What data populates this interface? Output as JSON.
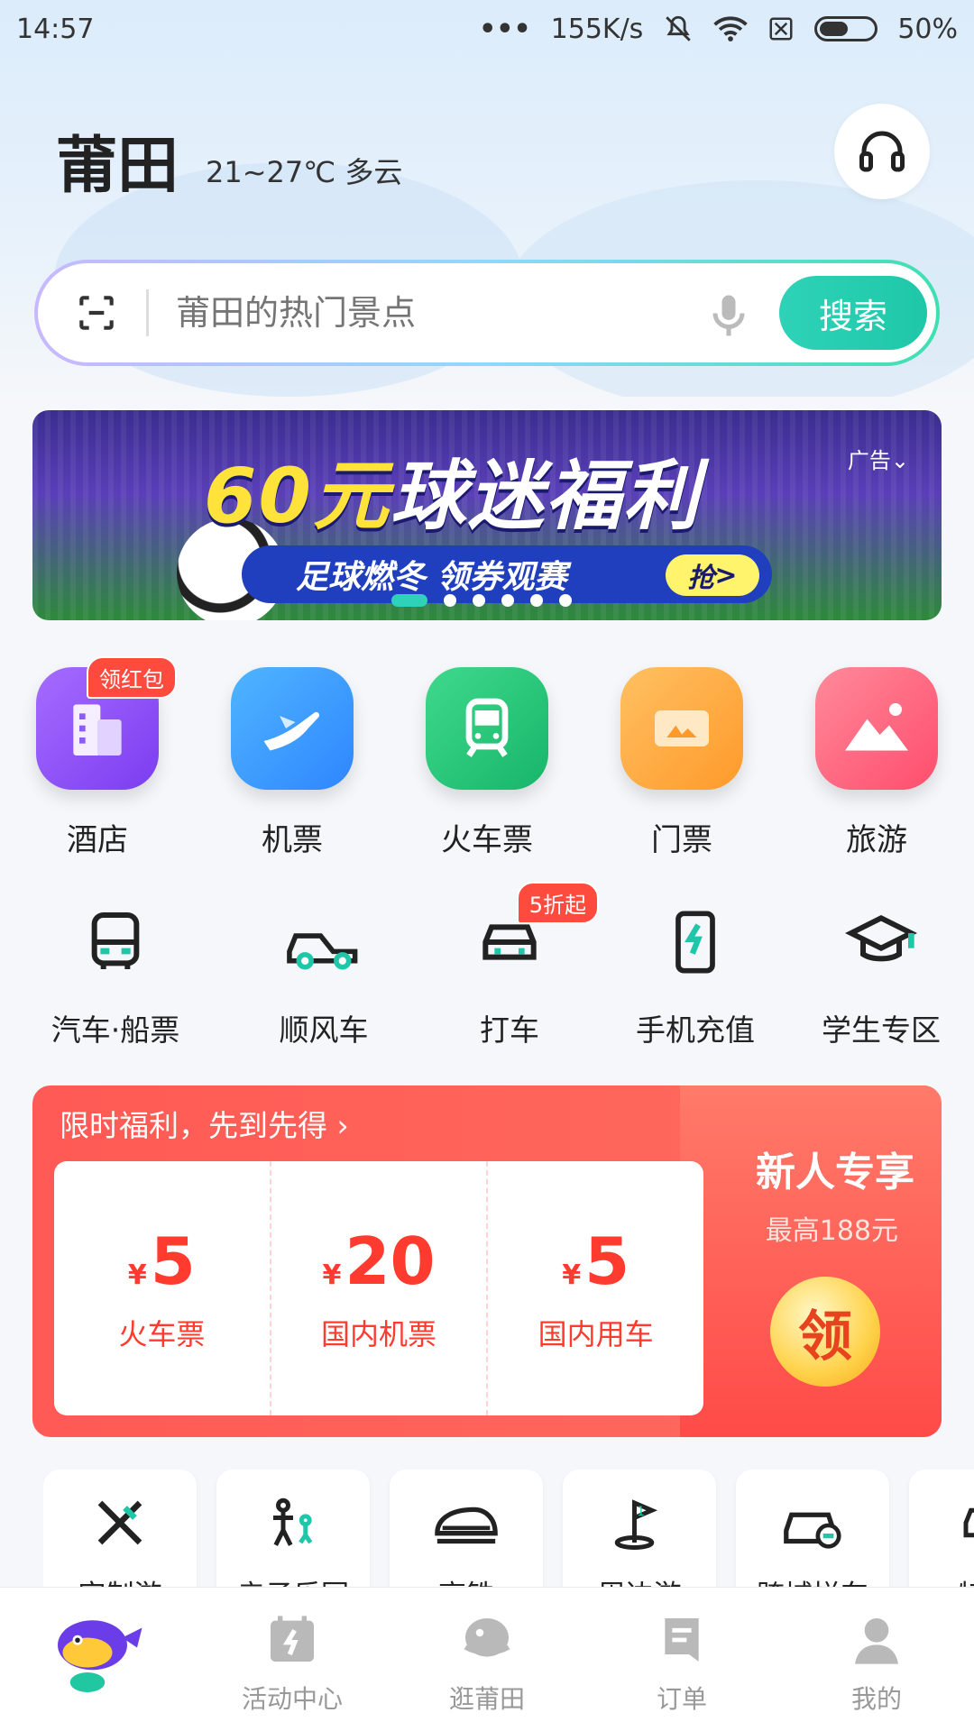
{
  "status_bar": {
    "time": "14:57",
    "speed": "155K/s",
    "battery": "50%"
  },
  "header": {
    "city": "莆田",
    "weather": "21~27℃ 多云"
  },
  "search": {
    "placeholder": "莆田的热门景点",
    "button": "搜索"
  },
  "banner": {
    "title_num": "60元",
    "title_text": "球迷福利",
    "subtitle": "足球燃冬 领券观赛",
    "cta": "抢",
    "ad_label": "广告",
    "page_count": 6,
    "active_page": 1
  },
  "main_grid": [
    {
      "label": "酒店",
      "icon": "hotel-icon",
      "color": "#8b5cf6",
      "badge": "领红包"
    },
    {
      "label": "机票",
      "icon": "plane-icon",
      "color": "#3b9bff",
      "badge": ""
    },
    {
      "label": "火车票",
      "icon": "train-icon",
      "color": "#22c27a",
      "badge": ""
    },
    {
      "label": "门票",
      "icon": "ticket-icon",
      "color": "#ffa23a",
      "badge": ""
    },
    {
      "label": "旅游",
      "icon": "mountain-icon",
      "color": "#ff5f7a",
      "badge": ""
    }
  ],
  "sub_grid": [
    {
      "label": "汽车·船票",
      "icon": "bus-icon",
      "badge": ""
    },
    {
      "label": "顺风车",
      "icon": "carpool-icon",
      "badge": ""
    },
    {
      "label": "打车",
      "icon": "taxi-icon",
      "badge": "5折起"
    },
    {
      "label": "手机充值",
      "icon": "phone-charge-icon",
      "badge": ""
    },
    {
      "label": "学生专区",
      "icon": "graduation-cap-icon",
      "badge": ""
    }
  ],
  "promo": {
    "header": "限时福利，先到先得",
    "tickets": [
      {
        "currency": "¥",
        "amount": "5",
        "name": "火车票"
      },
      {
        "currency": "¥",
        "amount": "20",
        "name": "国内机票"
      },
      {
        "currency": "¥",
        "amount": "5",
        "name": "国内用车"
      }
    ],
    "new_user": "新人专享",
    "max": "最高188元",
    "claim": "领"
  },
  "cards": [
    {
      "label": "定制游",
      "icon": "custom-tour-icon"
    },
    {
      "label": "亲子乐园",
      "icon": "family-park-icon"
    },
    {
      "label": "高铁",
      "icon": "high-speed-rail-icon"
    },
    {
      "label": "周边游",
      "icon": "nearby-tour-icon"
    },
    {
      "label": "跨城拼车",
      "icon": "intercity-carpool-icon"
    },
    {
      "label": "特价",
      "icon": "special-icon"
    }
  ],
  "tabbar": [
    {
      "label": "",
      "icon": "mascot-home-icon"
    },
    {
      "label": "活动中心",
      "icon": "activity-icon"
    },
    {
      "label": "逛莆田",
      "icon": "explore-icon"
    },
    {
      "label": "订单",
      "icon": "order-icon"
    },
    {
      "label": "我的",
      "icon": "profile-icon"
    }
  ]
}
